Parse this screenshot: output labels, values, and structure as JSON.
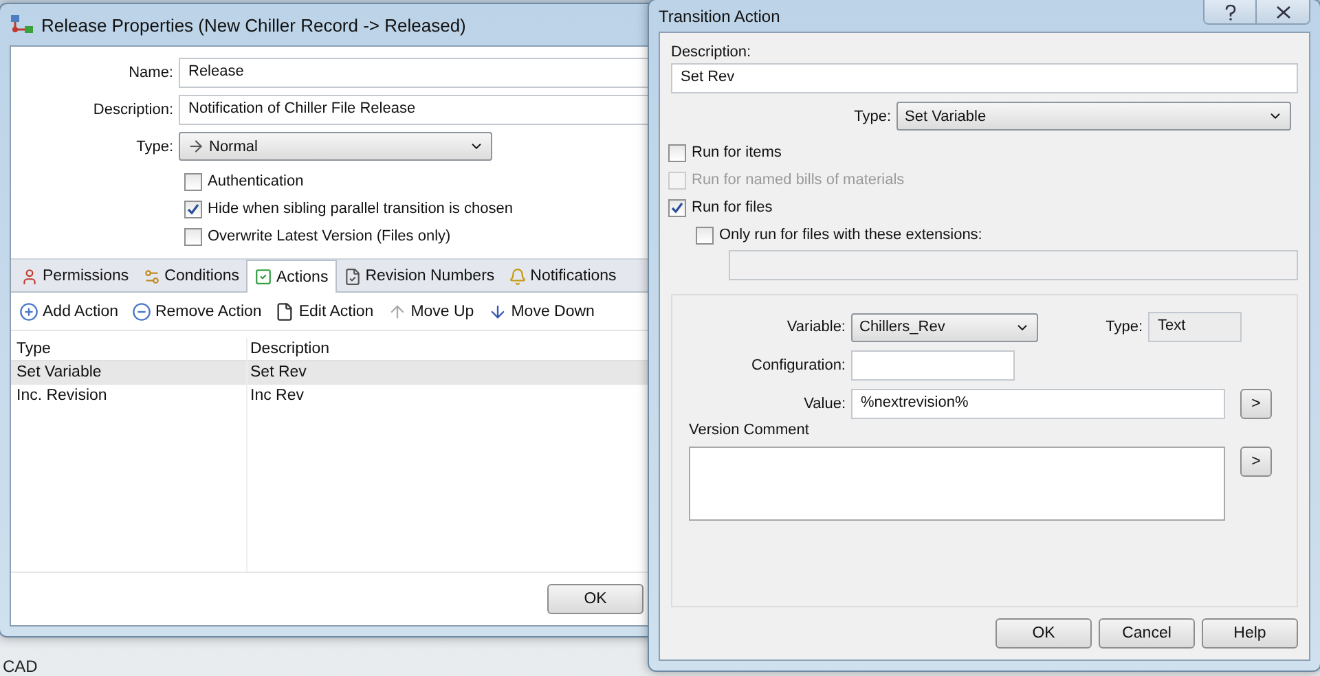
{
  "desktop": {
    "text": "CAD"
  },
  "release_window": {
    "title": "Release Properties (New Chiller Record -> Released)",
    "fields": [
      {
        "label": "Name:",
        "value": "Release"
      },
      {
        "label": "Description:",
        "value": "Notification of Chiller File Release"
      }
    ],
    "type_label": "Type:",
    "type_value": "Normal",
    "options": [
      {
        "label": "Authentication",
        "checked": false
      },
      {
        "label": "Hide when sibling parallel transition is chosen",
        "checked": true
      },
      {
        "label": "Overwrite Latest Version (Files only)",
        "checked": false
      }
    ],
    "tabs": [
      {
        "label": "Permissions",
        "selected": false
      },
      {
        "label": "Conditions",
        "selected": false
      },
      {
        "label": "Actions",
        "selected": true
      },
      {
        "label": "Revision Numbers",
        "selected": false
      },
      {
        "label": "Notifications",
        "selected": false
      }
    ],
    "toolbar": [
      "Add Action",
      "Remove Action",
      "Edit Action",
      "Move Up",
      "Move Down"
    ],
    "table": {
      "columns": [
        "Type",
        "Description"
      ],
      "rows": [
        {
          "cells": [
            "Set Variable",
            "Set Rev"
          ],
          "selected": true
        },
        {
          "cells": [
            "Inc. Revision",
            "Inc Rev"
          ],
          "selected": false
        }
      ]
    },
    "ok": "OK"
  },
  "action_dialog": {
    "title": "Transition Action",
    "description_label": "Description:",
    "description": "Set Rev",
    "type_label": "Type:",
    "type_value": "Set Variable",
    "options": [
      {
        "label": "Run for items",
        "checked": false,
        "disabled": false
      },
      {
        "label": "Run for named bills of materials",
        "checked": false,
        "disabled": true
      },
      {
        "label": "Run for files",
        "checked": true,
        "disabled": false,
        "children": [
          {
            "label": "Only run for files with these extensions:",
            "checked": false,
            "disabled": false
          }
        ]
      }
    ],
    "variable_label": "Variable:",
    "variable": "Chillers_Rev",
    "var_type_label": "Type:",
    "var_type": "Text",
    "configuration_label": "Configuration:",
    "value_label": "Value:",
    "value": "%nextrevision%",
    "insert_button": ">",
    "version_comment_label": "Version Comment",
    "comment_insert_button": ">",
    "buttons": [
      "OK",
      "Cancel",
      "Help"
    ]
  }
}
